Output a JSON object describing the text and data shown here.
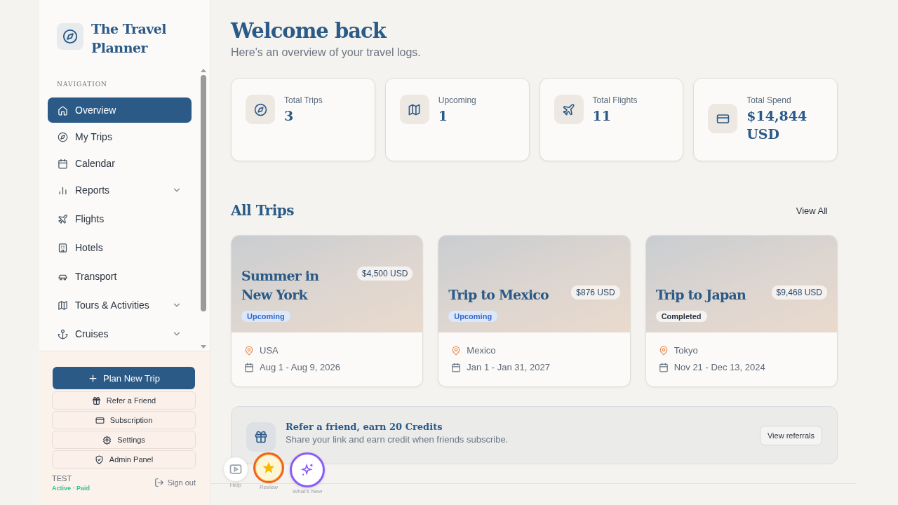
{
  "brand": {
    "title": "The Travel Planner"
  },
  "navigation": {
    "heading": "NAVIGATION",
    "items": [
      {
        "label": "Overview",
        "selected": true,
        "has_submenu": false
      },
      {
        "label": "My Trips",
        "selected": false,
        "has_submenu": false
      },
      {
        "label": "Calendar",
        "selected": false,
        "has_submenu": false
      },
      {
        "label": "Reports",
        "selected": false,
        "has_submenu": true
      },
      {
        "label": "Flights",
        "selected": false,
        "has_submenu": false
      },
      {
        "label": "Hotels",
        "selected": false,
        "has_submenu": false
      },
      {
        "label": "Transport",
        "selected": false,
        "has_submenu": false
      },
      {
        "label": "Tours & Activities",
        "selected": false,
        "has_submenu": true
      },
      {
        "label": "Cruises",
        "selected": false,
        "has_submenu": true
      }
    ]
  },
  "sidebar_actions": {
    "primary": "Plan New Trip",
    "buttons": [
      "Refer a Friend",
      "Subscription",
      "Settings",
      "Admin Panel"
    ]
  },
  "user": {
    "name": "TEST",
    "status": "Active · Paid",
    "sign_out": "Sign out"
  },
  "header": {
    "title": "Welcome back",
    "subtitle": "Here's an overview of your travel logs."
  },
  "stats": [
    {
      "label": "Total Trips",
      "value": "3"
    },
    {
      "label": "Upcoming",
      "value": "1"
    },
    {
      "label": "Total Flights",
      "value": "11"
    },
    {
      "label": "Total Spend",
      "value": "$14,844 USD"
    }
  ],
  "trips_section": {
    "title": "All Trips",
    "view_all": "View All",
    "trips": [
      {
        "title": "Summer in New York",
        "price": "$4,500 USD",
        "status": "Upcoming",
        "kind": "upcoming",
        "location": "USA",
        "dates": "Aug 1 - Aug 9, 2026"
      },
      {
        "title": "Trip to Mexico",
        "price": "$876 USD",
        "status": "Upcoming",
        "kind": "upcoming",
        "location": "Mexico",
        "dates": "Jan 1 - Jan 31, 2027"
      },
      {
        "title": "Trip to Japan",
        "price": "$9,468 USD",
        "status": "Completed",
        "kind": "completed",
        "location": "Tokyo",
        "dates": "Nov 21 - Dec 13, 2024"
      }
    ]
  },
  "referral": {
    "title": "Refer a friend, earn 20 Credits",
    "text": "Share your link and earn credit when friends subscribe.",
    "button": "View referrals"
  },
  "quick_actions": [
    {
      "label": "Help",
      "kind": "help"
    },
    {
      "label": "Review",
      "kind": "review"
    },
    {
      "label": "What's New",
      "kind": "whats_new"
    }
  ]
}
